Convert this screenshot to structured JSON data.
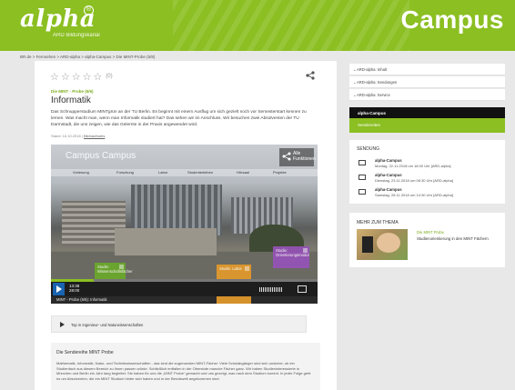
{
  "header": {
    "logo_text": "alpha",
    "logo_badge": "®",
    "logo_subtitle": "ARD Bildungskanal",
    "campus_title": "Campus",
    "brand_color": "#8bbf22"
  },
  "breadcrumb": "BR.de > Fernsehen > ARD-alpha > alpha-Campus > Die MINT-Probe (5/8)",
  "article": {
    "rating_stars": "☆☆☆☆☆",
    "rating_count": "(0)",
    "subline": "Die MINT - Probe (5/6)",
    "title": "Informatik",
    "teaser": "Das Schnupperstudium MINTgrün an der TU Berlin. Es beginnt mit einem Ausflug um sich gezielt noch vor Semesterstart kennen zu lernen. Was macht man, wenn man Informatik studiert hat? Das sehen wir im Anschluss. Wir besuchen zwei Absolventen der TU Darmstadt, die uns zeigen, wie das Gelernte in der Praxis angewendet wird.",
    "date_prefix": "Stand: 16.10.2018",
    "date_link": "Bildnachweis"
  },
  "player": {
    "overlay_title": "Campus Campus",
    "tabs": [
      "Vorlesung",
      "Forschung",
      "Labor",
      "Studentenleben",
      "Hörsaal",
      "Projekte"
    ],
    "share_label": "Alle Funktionen",
    "hotspot_green": "Studie: Wissenschaftsfächer",
    "hotspot_orange": "Studie: Labor",
    "hotspot_purple": "Studie: Orientierungsmodul",
    "progress_fraction": 0.16,
    "time_current": "13:38",
    "time_total": "28:00",
    "caption": "MINT - Probe (5/6): Informatik"
  },
  "tag_box": {
    "label": "Top in Ingenieur- und Naturwissenschaften"
  },
  "info_box": {
    "heading": "Die Sendereihe MINT Probe",
    "body": "Mathematik, Informatik, Natur- und Technikwissenschaften - das sind die sogenannten MINT-Fächer. Viele Schulabgänger sind sich unsicher, ob ein Studienfach aus diesem Bereich zu ihnen passen würde. Schließlich entfallen in der Oberstufe manche Fächer ganz. Wir haben Studieninteressierte in München und Berlin ein Jahr lang begleitet. Sie haben für uns die „MINT Probe“ gemacht und uns gezeigt, was nach dem Studium kommt. In jeder Folge geht es um Absolventen, die ein MINT Studium hinter sich haben und in der Berufswelt angekommen sind."
  },
  "sidebar": {
    "accordion": [
      "ARD-alpha: Inhalt",
      "ARD-alpha: Sendungen",
      "ARD-alpha: Service"
    ],
    "campus_black": "alpha-Campus",
    "campus_green": "Sendezeiten",
    "sendung_heading": "SENDUNG",
    "sendung_items": [
      {
        "title": "alpha-Campus",
        "time": "Montag, 22.11.2018 um 18:00 Uhr [ARD-alpha]"
      },
      {
        "title": "alpha-Campus",
        "time": "Dienstag, 23.11.2018 um 06:30 Uhr [ARD-alpha]"
      },
      {
        "title": "alpha-Campus",
        "time": "Samstag, 28.11.2018 um 14:30 Uhr [ARD-alpha]"
      }
    ],
    "more_heading": "MEHR ZUM THEMA",
    "more_sub": "Die MINT Probe",
    "more_desc": "Studienorientierung in den MINT Fächern"
  }
}
